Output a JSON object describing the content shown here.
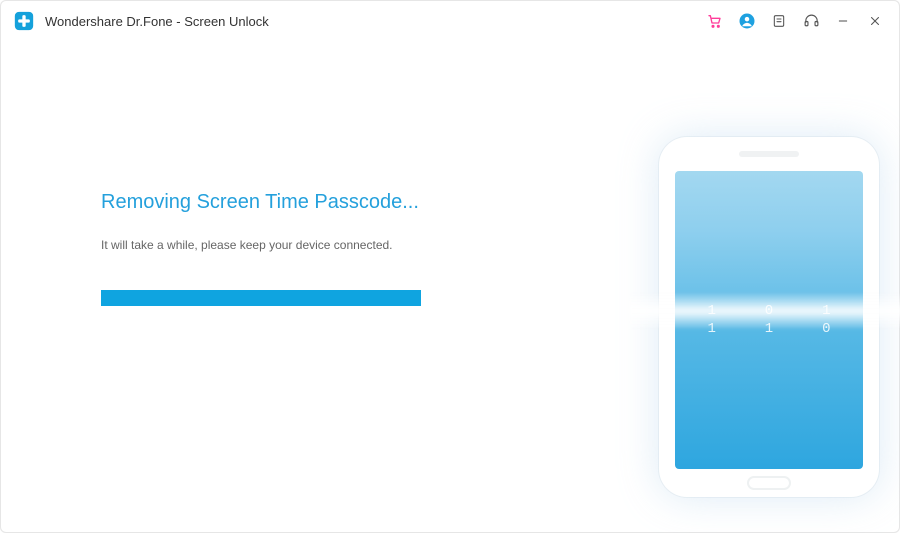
{
  "titlebar": {
    "title": "Wondershare Dr.Fone - Screen Unlock"
  },
  "main": {
    "heading": "Removing Screen Time Passcode...",
    "subtext": "It will take a while, please keep your device connected.",
    "progress_percent": 100
  },
  "phone": {
    "digits_top": [
      "1",
      "0",
      "1"
    ],
    "digits_bot": [
      "1",
      "1",
      "0"
    ]
  }
}
